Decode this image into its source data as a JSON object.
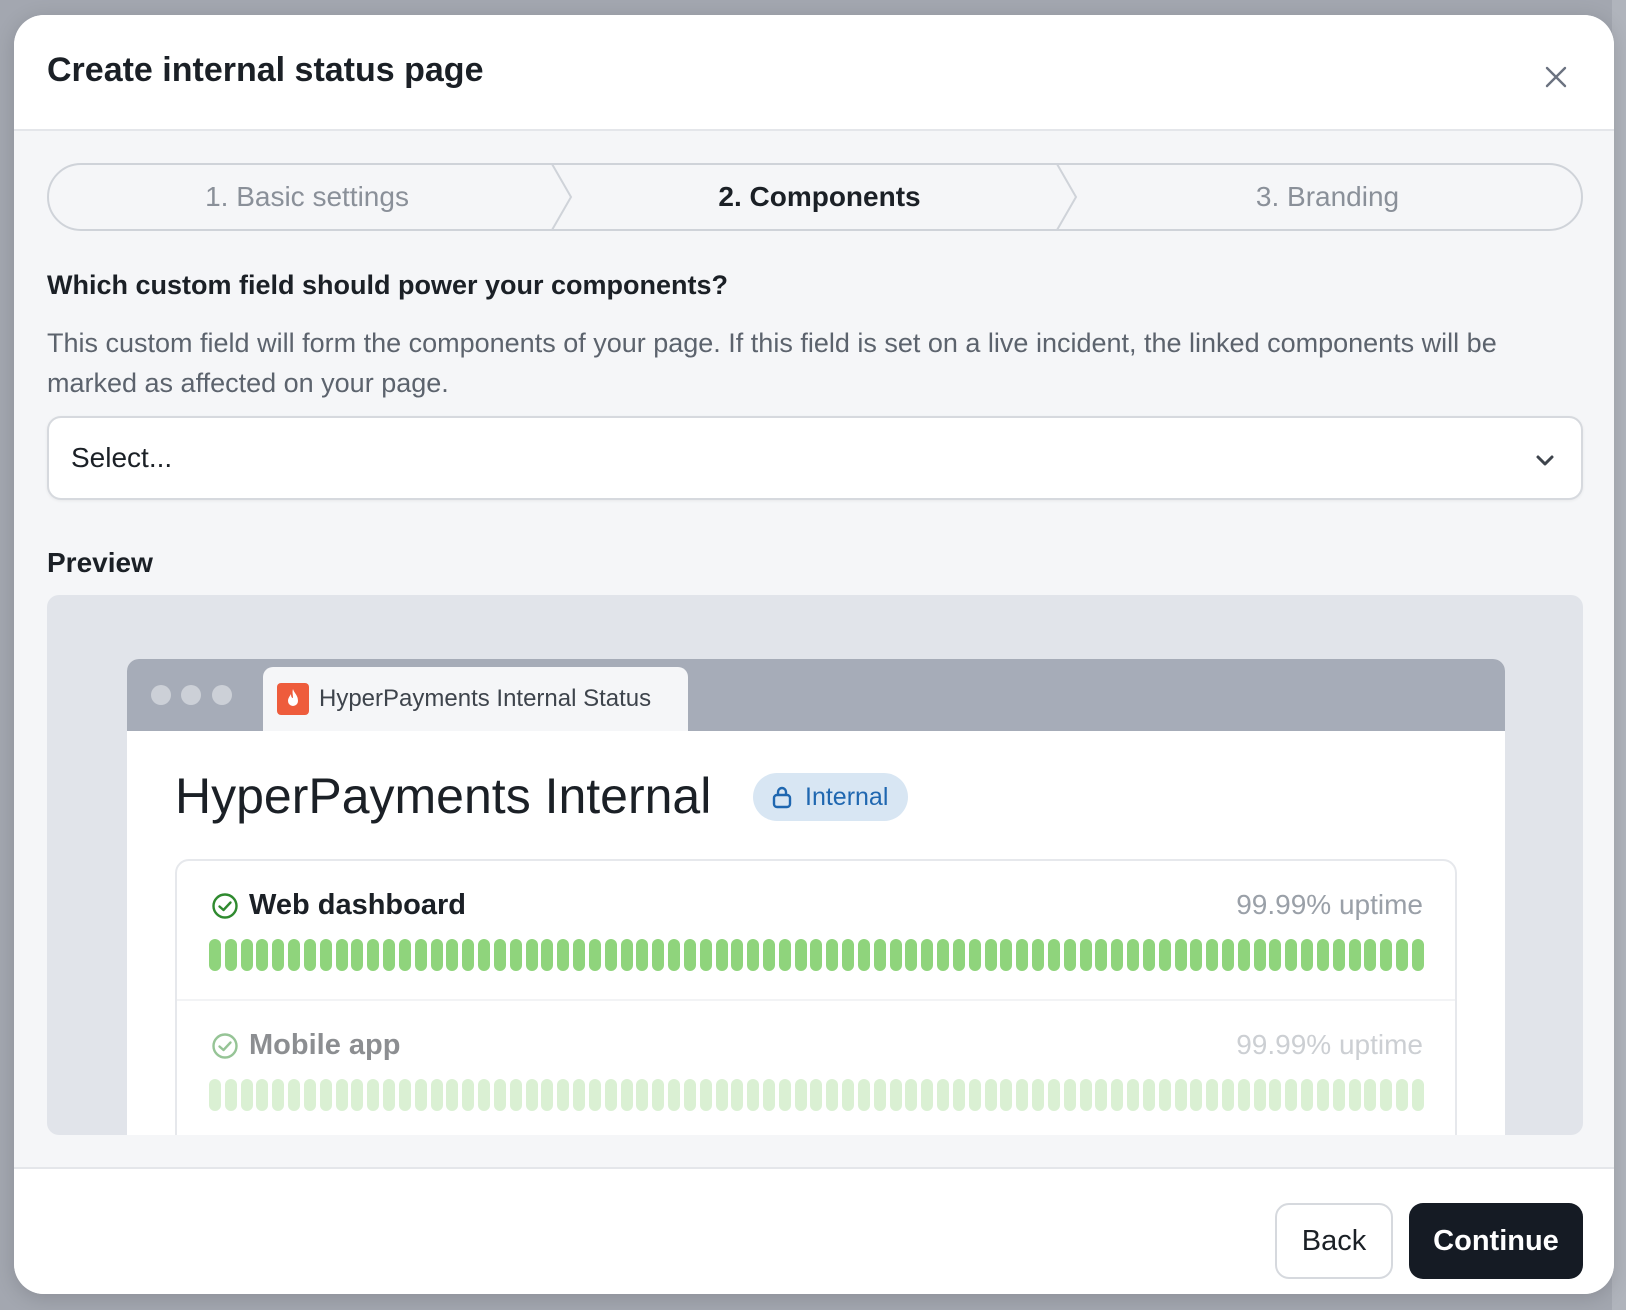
{
  "modal": {
    "title": "Create internal status page",
    "close_icon": "close-icon"
  },
  "stepper": {
    "steps": [
      {
        "label": "1. Basic settings",
        "state": "inactive"
      },
      {
        "label": "2. Components",
        "state": "active"
      },
      {
        "label": "3. Branding",
        "state": "inactive"
      }
    ]
  },
  "field": {
    "question": "Which custom field should power your components?",
    "help_text": "This custom field will form the components of your page. If this field is set on a live incident, the linked components will be marked as affected on your page.",
    "select_placeholder": "Select...",
    "chevron_icon": "chevron-down-icon"
  },
  "preview": {
    "label": "Preview",
    "browser_tab_title": "HyperPayments Internal Status",
    "favicon_icon": "flame-icon",
    "page_heading": "HyperPayments Internal",
    "badge_label": "Internal",
    "badge_icon": "lock-icon",
    "components": [
      {
        "name": "Web dashboard",
        "uptime": "99.99% uptime",
        "status_icon": "check-circle-icon"
      },
      {
        "name": "Mobile app",
        "uptime": "99.99% uptime",
        "status_icon": "check-circle-icon"
      }
    ]
  },
  "footer": {
    "back_label": "Back",
    "continue_label": "Continue"
  },
  "colors": {
    "primary_button": "#151b24",
    "uptime_green": "#8fd47c",
    "badge_blue": "#1f67b0",
    "favicon": "#ee5c3c"
  }
}
